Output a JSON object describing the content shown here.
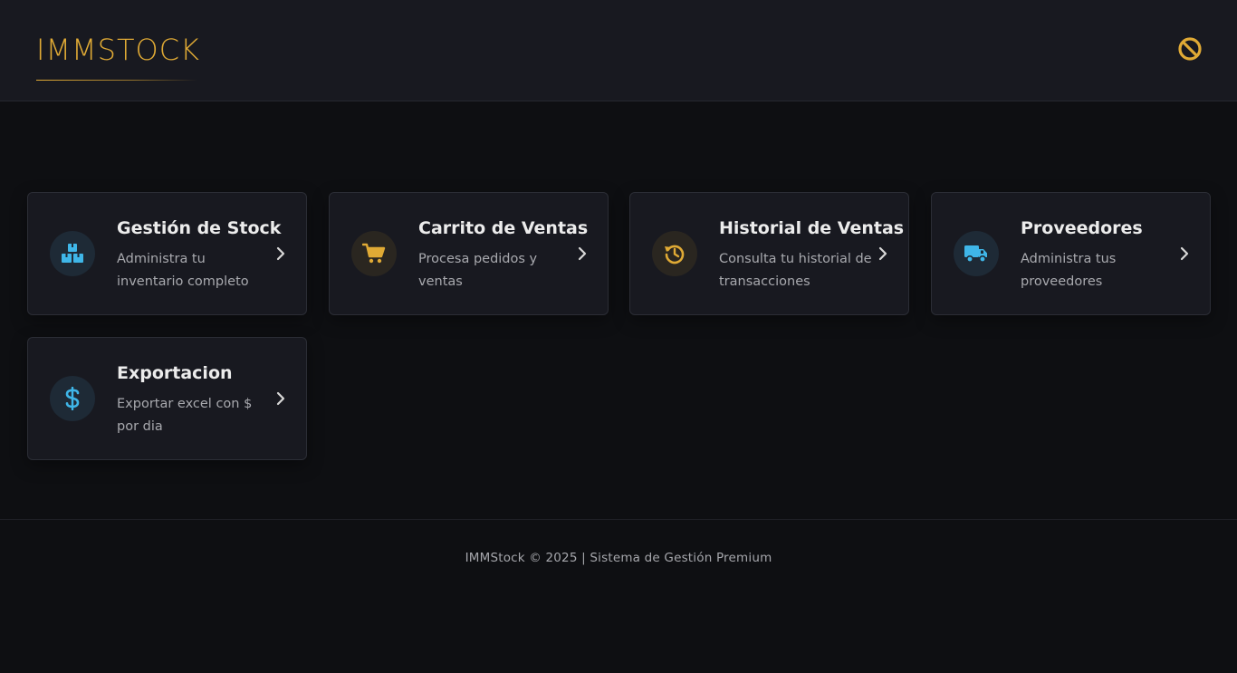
{
  "header": {
    "brand": "IMMSTOCK",
    "action_icon": "ban-icon"
  },
  "colors": {
    "accent_gold": "#e0aa35",
    "accent_blue": "#3fb6e8",
    "card_bg": "#181920",
    "page_bg": "#0e0f12"
  },
  "cards": [
    {
      "title": "Gestión de Stock",
      "description": "Administra tu inventario completo",
      "icon": "boxes-icon"
    },
    {
      "title": "Carrito de Ventas",
      "description": "Procesa pedidos y ventas",
      "icon": "cart-icon"
    },
    {
      "title": "Historial de Ventas",
      "description": "Consulta tu historial de transacciones",
      "icon": "history-icon"
    },
    {
      "title": "Proveedores",
      "description": "Administra tus proveedores",
      "icon": "truck-icon"
    },
    {
      "title": "Exportacion",
      "description": "Exportar excel con $ por dia",
      "icon": "dollar-icon"
    }
  ],
  "footer": {
    "text": "IMMStock © 2025 | Sistema de Gestión Premium"
  }
}
